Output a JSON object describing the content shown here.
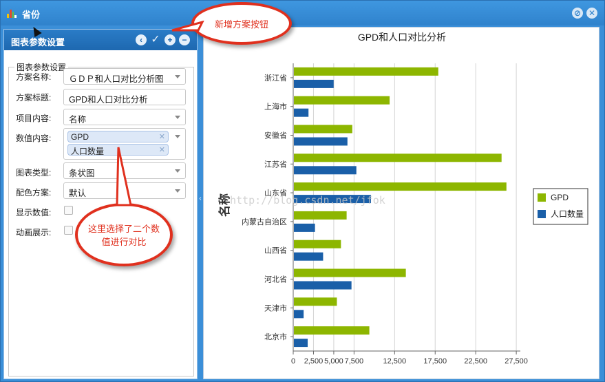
{
  "window": {
    "title": "省份",
    "minimize_icon": "minus-circle-icon",
    "close_icon": "close-circle-icon"
  },
  "left_panel": {
    "header": "图表参数设置",
    "tools": [
      "back-icon",
      "check-icon",
      "add-icon",
      "remove-icon"
    ],
    "legend": "图表参数设置",
    "fields": {
      "scheme_name": {
        "label": "方案名称:",
        "value": "ＧＤＰ和人口对比分析图"
      },
      "scheme_title": {
        "label": "方案标题:",
        "value": "GPD和人口对比分析"
      },
      "item_content": {
        "label": "项目内容:",
        "value": "名称"
      },
      "value_content": {
        "label": "数值内容:",
        "tags": [
          "GPD",
          "人口数量"
        ]
      },
      "chart_type": {
        "label": "图表类型:",
        "value": "条状图"
      },
      "color_scheme": {
        "label": "配色方案:",
        "value": "默认"
      },
      "show_values": {
        "label": "显示数值:",
        "checked": false
      },
      "animation": {
        "label": "动画展示:",
        "checked": false
      }
    }
  },
  "callouts": {
    "new_scheme": "新增方案按钮",
    "multi_select": "这里选择了二个数值进行对比"
  },
  "watermark": "http://blog.csdn.net/jfok",
  "colors": {
    "titlebar": "#2f82cc",
    "gpd": "#8db600",
    "population": "#1a5fa8",
    "callout": "#e0301e"
  },
  "chart_data": {
    "type": "bar",
    "orientation": "horizontal",
    "title": "GPD和人口对比分析",
    "ylabel": "名称",
    "xlabel": "",
    "categories": [
      "浙江省",
      "上海市",
      "安徽省",
      "江苏省",
      "山东省",
      "内蒙古自治区",
      "山西省",
      "河北省",
      "天津市",
      "北京市"
    ],
    "series": [
      {
        "name": "GPD",
        "color": "#8db600",
        "values": [
          17800,
          11800,
          7200,
          25600,
          26200,
          6500,
          5800,
          13800,
          5300,
          9300
        ]
      },
      {
        "name": "人口数量",
        "color": "#1a5fa8",
        "values": [
          4900,
          1800,
          6600,
          7700,
          9500,
          2600,
          3600,
          7100,
          1200,
          1700
        ]
      }
    ],
    "xticks": [
      "0",
      "2,500",
      "5,000",
      "7,500",
      "12,500",
      "17,500",
      "22,500",
      "27,500"
    ],
    "xlim": [
      0,
      28000
    ],
    "grid": true,
    "legend_position": "right"
  }
}
